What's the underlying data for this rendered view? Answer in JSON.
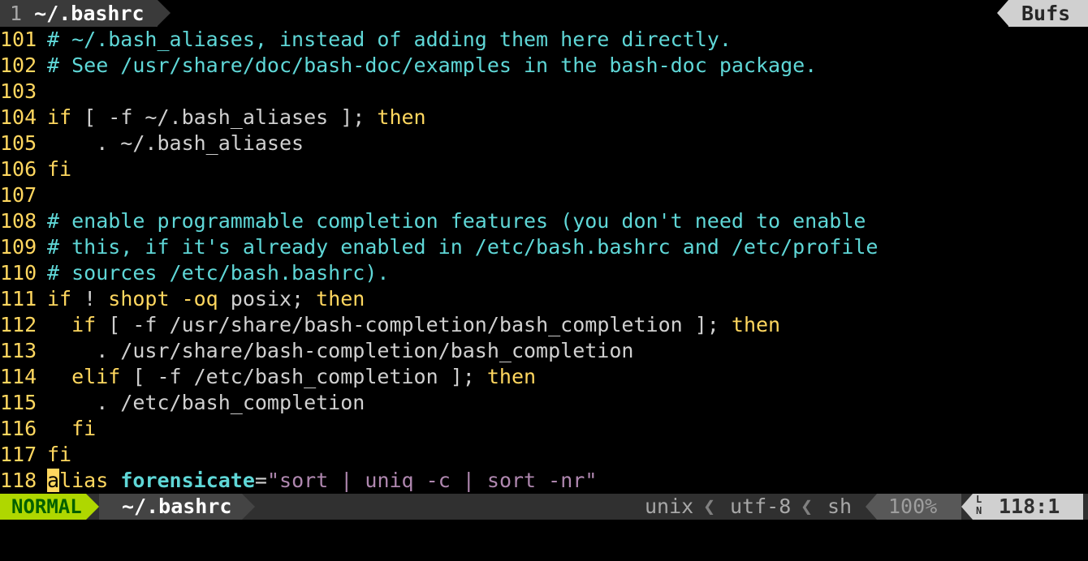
{
  "tabline": {
    "tab_number": "1",
    "tab_name": "~/.bashrc",
    "buffers_label": "Bufs"
  },
  "code_lines": [
    {
      "num": "101",
      "parts": [
        {
          "t": "# ~/.bash_aliases, instead of adding them here directly.",
          "c": "cm"
        }
      ]
    },
    {
      "num": "102",
      "parts": [
        {
          "t": "# See /usr/share/doc/bash-doc/examples in the bash-doc package.",
          "c": "cm"
        }
      ]
    },
    {
      "num": "103",
      "parts": []
    },
    {
      "num": "104",
      "parts": [
        {
          "t": "if",
          "c": "kw"
        },
        {
          "t": " [ -f ~/.bash_aliases ]; ",
          "c": "tx"
        },
        {
          "t": "then",
          "c": "kw"
        }
      ]
    },
    {
      "num": "105",
      "parts": [
        {
          "t": "    . ~/.bash_aliases",
          "c": "tx"
        }
      ]
    },
    {
      "num": "106",
      "parts": [
        {
          "t": "fi",
          "c": "kw"
        }
      ]
    },
    {
      "num": "107",
      "parts": []
    },
    {
      "num": "108",
      "parts": [
        {
          "t": "# enable programmable completion features (you don't need to enable",
          "c": "cm"
        }
      ]
    },
    {
      "num": "109",
      "parts": [
        {
          "t": "# this, if it's already enabled in /etc/bash.bashrc and /etc/profile",
          "c": "cm"
        }
      ]
    },
    {
      "num": "110",
      "parts": [
        {
          "t": "# sources /etc/bash.bashrc).",
          "c": "cm"
        }
      ]
    },
    {
      "num": "111",
      "parts": [
        {
          "t": "if",
          "c": "kw"
        },
        {
          "t": " ! ",
          "c": "tx"
        },
        {
          "t": "shopt",
          "c": "kw"
        },
        {
          "t": " -oq ",
          "c": "kw"
        },
        {
          "t": "posix; ",
          "c": "tx"
        },
        {
          "t": "then",
          "c": "kw"
        }
      ]
    },
    {
      "num": "112",
      "parts": [
        {
          "t": "  if",
          "c": "kw"
        },
        {
          "t": " [ -f /usr/share/bash-completion/bash_completion ]; ",
          "c": "tx"
        },
        {
          "t": "then",
          "c": "kw"
        }
      ]
    },
    {
      "num": "113",
      "parts": [
        {
          "t": "    . /usr/share/bash-completion/bash_completion",
          "c": "tx"
        }
      ]
    },
    {
      "num": "114",
      "parts": [
        {
          "t": "  elif",
          "c": "kw"
        },
        {
          "t": " [ -f /etc/bash_completion ]; ",
          "c": "tx"
        },
        {
          "t": "then",
          "c": "kw"
        }
      ]
    },
    {
      "num": "115",
      "parts": [
        {
          "t": "    . /etc/bash_completion",
          "c": "tx"
        }
      ]
    },
    {
      "num": "116",
      "parts": [
        {
          "t": "  fi",
          "c": "kw"
        }
      ]
    },
    {
      "num": "117",
      "parts": [
        {
          "t": "fi",
          "c": "kw"
        }
      ]
    },
    {
      "num": "118",
      "parts": [
        {
          "t": "a",
          "c": "cursor"
        },
        {
          "t": "lias",
          "c": "kw"
        },
        {
          "t": " ",
          "c": "tx"
        },
        {
          "t": "forensicate",
          "c": "fn"
        },
        {
          "t": "=",
          "c": "tx"
        },
        {
          "t": "\"sort | uniq -c | sort -nr\"",
          "c": "st"
        }
      ]
    }
  ],
  "statusline": {
    "mode": "NORMAL",
    "file": "~/.bashrc",
    "fileformat": "unix",
    "encoding": "utf-8",
    "filetype": "sh",
    "percent": "100%",
    "line_icon_top": "L",
    "line_icon_bottom": "N",
    "line": "118",
    "colon": ":",
    "column": "1"
  },
  "colors": {
    "keyword": "#ffd75f",
    "comment": "#5fd7d7",
    "string": "#af87af",
    "mode_bg": "#afd700"
  }
}
